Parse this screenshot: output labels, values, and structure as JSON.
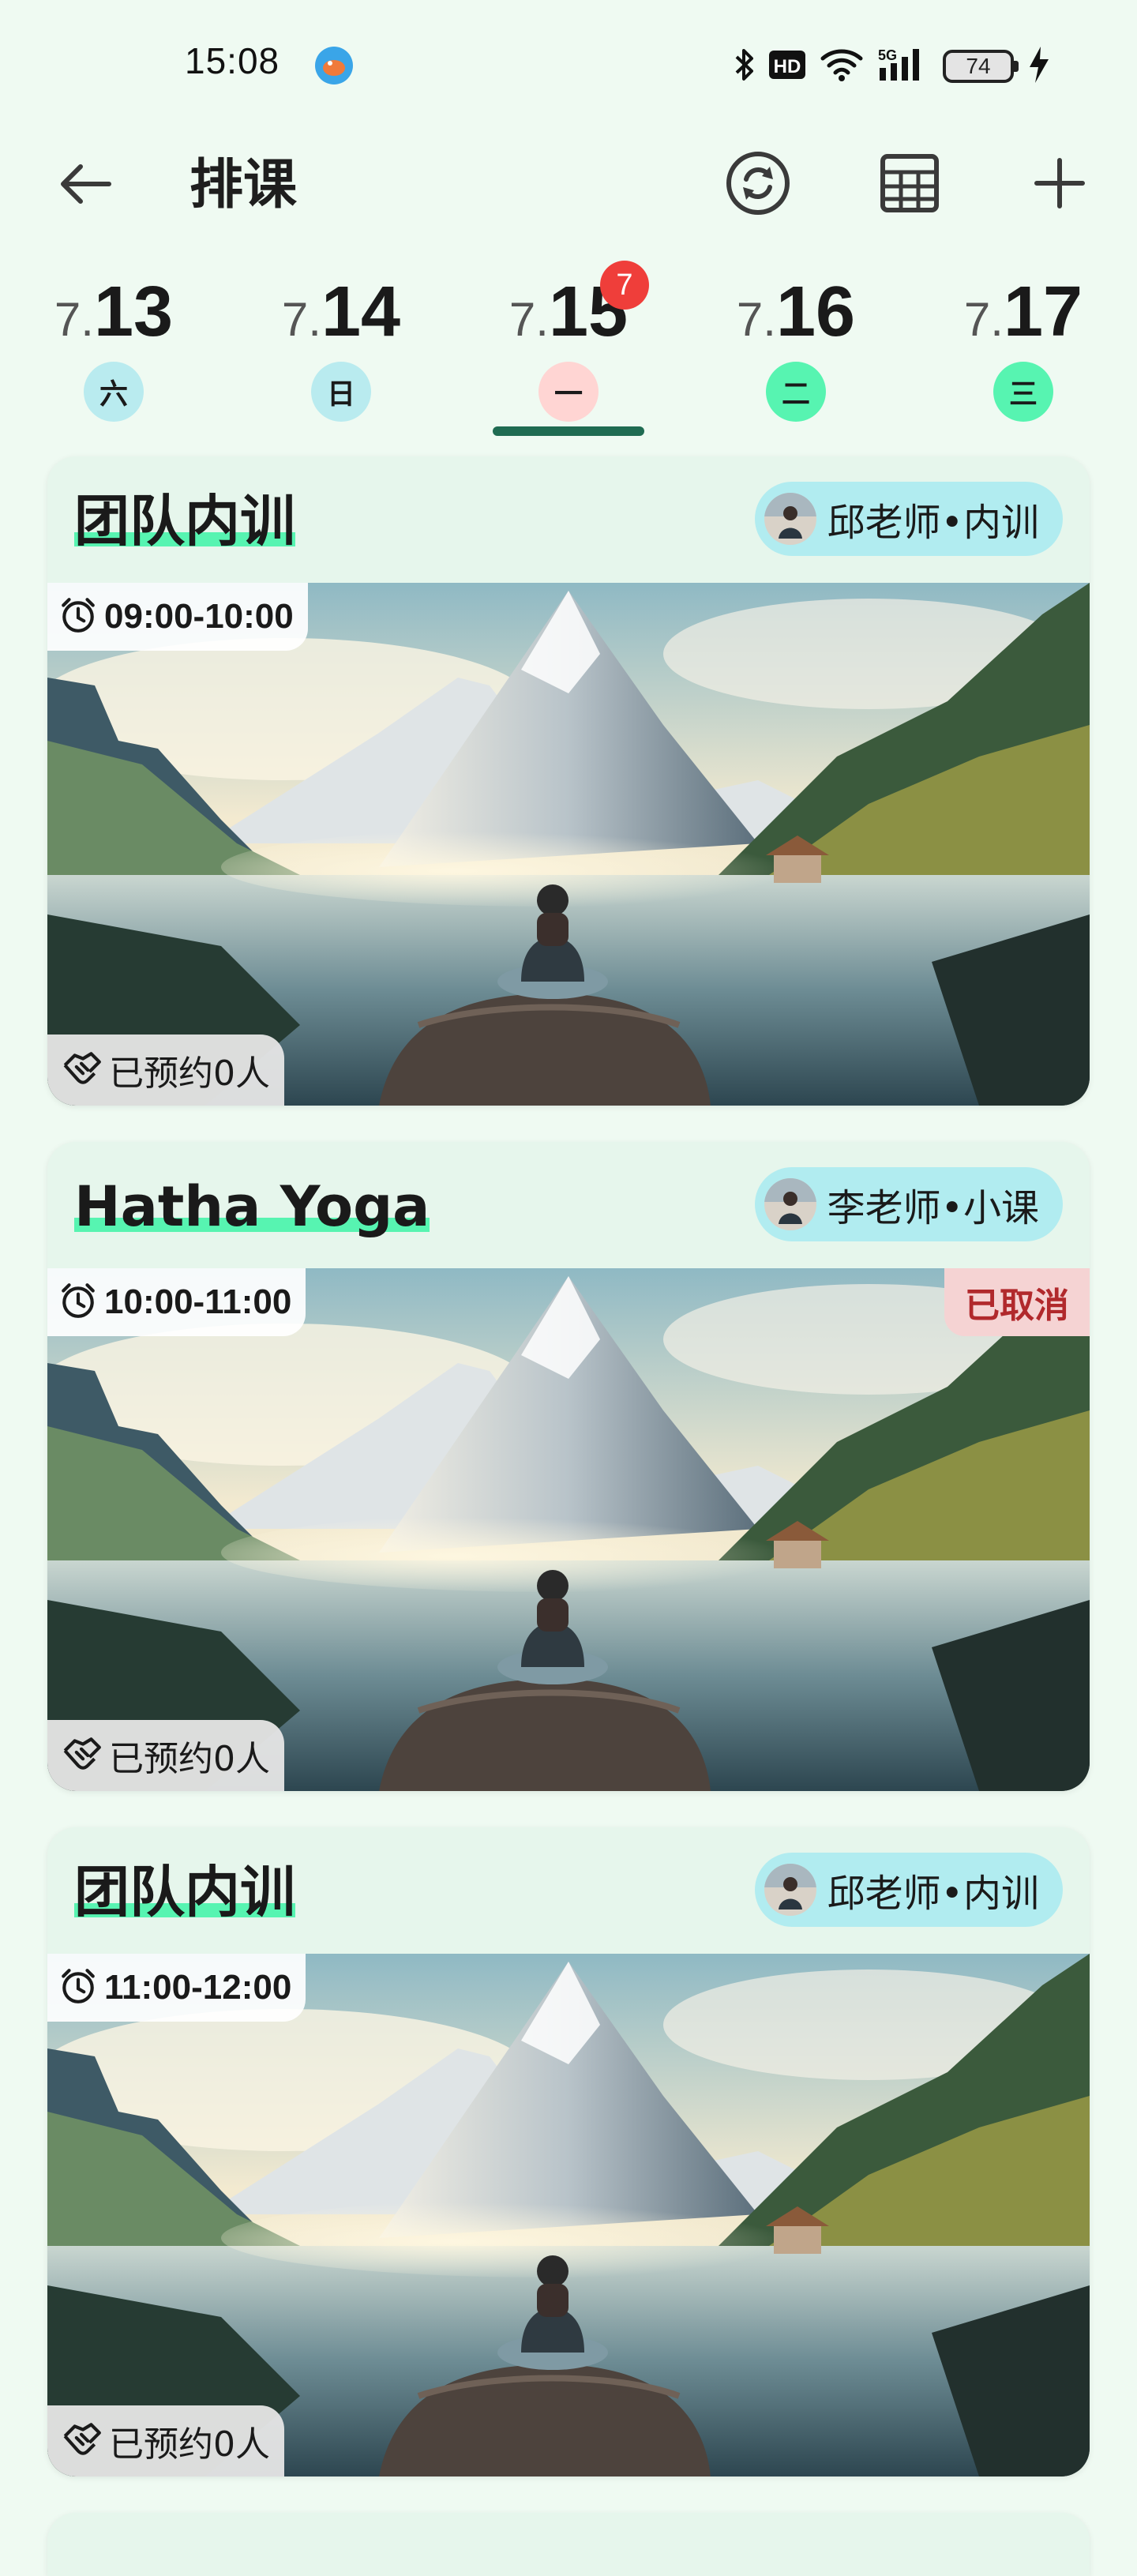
{
  "status_bar": {
    "time": "15:08",
    "battery": "74",
    "icons": [
      "bluetooth-icon",
      "hd-icon",
      "wifi-icon",
      "5g-signal-icon",
      "battery-icon",
      "charging-icon"
    ]
  },
  "header": {
    "title": "排课",
    "actions": [
      "back-arrow-icon",
      "sync-icon",
      "calendar-grid-icon",
      "add-icon"
    ]
  },
  "date_tabs": [
    {
      "month": "7.",
      "day": "13",
      "weekday": "六",
      "state": "past"
    },
    {
      "month": "7.",
      "day": "14",
      "weekday": "日",
      "state": "past"
    },
    {
      "month": "7.",
      "day": "15",
      "weekday": "一",
      "state": "selected",
      "badge": "7"
    },
    {
      "month": "7.",
      "day": "16",
      "weekday": "二",
      "state": "future"
    },
    {
      "month": "7.",
      "day": "17",
      "weekday": "三",
      "state": "future"
    }
  ],
  "courses": [
    {
      "title": "团队内训",
      "teacher": "邱老师•内训",
      "time": "09:00-10:00",
      "booked": "已预约0人",
      "cancelled": ""
    },
    {
      "title": "Hatha Yoga",
      "teacher": "李老师•小课",
      "time": "10:00-11:00",
      "booked": "已预约0人",
      "cancelled": "已取消"
    },
    {
      "title": "团队内训",
      "teacher": "邱老师•内训",
      "time": "11:00-12:00",
      "booked": "已预约0人",
      "cancelled": ""
    }
  ],
  "colors": {
    "background": "#effaf2",
    "card": "#e6f6ec",
    "accent_green": "#57f4b1",
    "selected_indicator": "#1f6b52",
    "badge_red": "#ef3e3a",
    "teacher_pill": "#b1ecf0",
    "cancel_bg": "#f5d3d3",
    "cancel_text": "#b1292c"
  }
}
